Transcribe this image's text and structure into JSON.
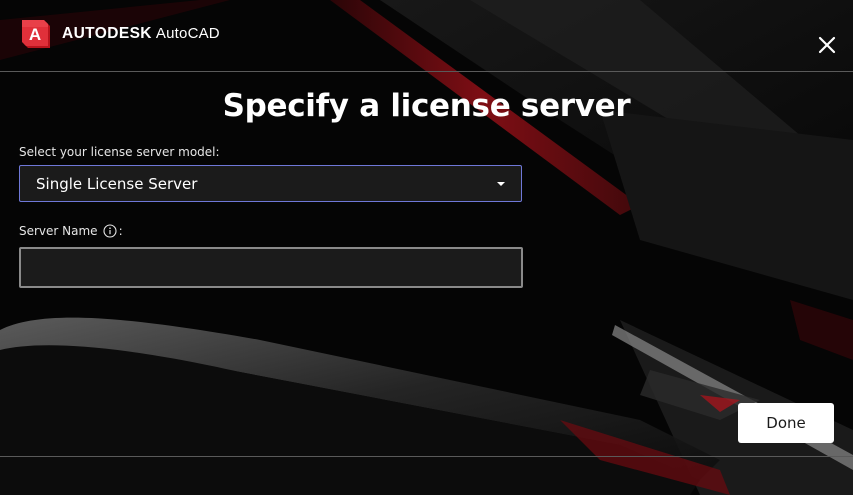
{
  "header": {
    "brand_name": "AUTODESK",
    "product_name": "AutoCAD",
    "logo_letter": "A",
    "logo_icon": "autocad-logo-icon",
    "close_icon": "close-icon"
  },
  "dialog": {
    "title": "Specify a license server",
    "model_label": "Select your license server model:",
    "model_selected": "Single License Server",
    "server_name_label": "Server Name",
    "server_name_suffix": ":",
    "server_name_value": "",
    "info_icon": "info-icon",
    "done_label": "Done"
  },
  "colors": {
    "accent_red": "#d7262e",
    "focus_border": "#6f78d8",
    "field_background": "#1b1b1b",
    "button_background": "#ffffff"
  }
}
